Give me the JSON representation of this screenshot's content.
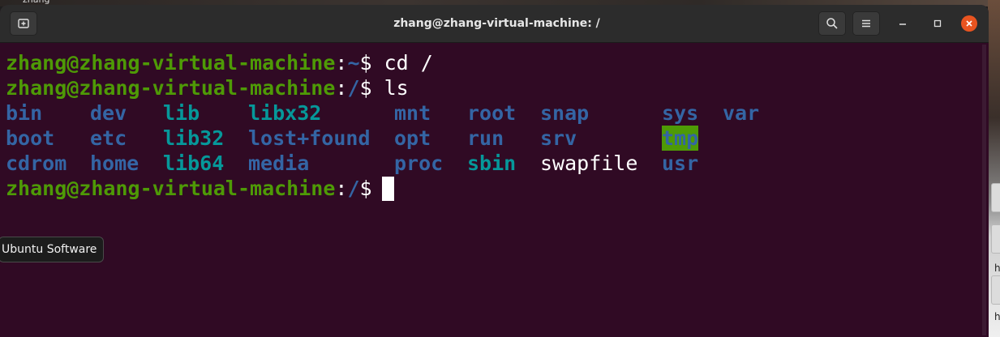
{
  "window": {
    "title": "zhang@zhang-virtual-machine: /"
  },
  "icons": {
    "new_tab": "new-tab-icon",
    "search": "search-icon",
    "menu": "hamburger-menu-icon",
    "minimize": "minimize-icon",
    "maximize": "maximize-icon",
    "close": "close-icon"
  },
  "colors": {
    "terminal_bg": "#300a24",
    "prompt_user": "#4e9a06",
    "directory": "#3465a4",
    "symlink": "#06989a",
    "close_button": "#e95420"
  },
  "terminal": {
    "lines": [
      {
        "user": "zhang@zhang-virtual-machine",
        "colon": ":",
        "path": "~",
        "suffix": "$ cd /"
      },
      {
        "user": "zhang@zhang-virtual-machine",
        "colon": ":",
        "path": "/",
        "suffix": "$ ls"
      }
    ],
    "listing": [
      [
        "bin",
        "dev",
        "lib",
        "libx32",
        "mnt",
        "root",
        "snap",
        "sys",
        "var"
      ],
      [
        "boot",
        "etc",
        "lib32",
        "lost+found",
        "opt",
        "run",
        "srv",
        "tmp"
      ],
      [
        "cdrom",
        "home",
        "lib64",
        "media",
        "proc",
        "sbin",
        "swapfile",
        "usr"
      ]
    ],
    "final_prompt": {
      "user": "zhang@zhang-virtual-machine",
      "colon": ":",
      "path": "/",
      "suffix": "$ "
    }
  },
  "tooltip": {
    "text": "Ubuntu Software"
  },
  "desktop": {
    "top_label": "zhang",
    "right_glyphs": [
      "h",
      "h"
    ]
  }
}
